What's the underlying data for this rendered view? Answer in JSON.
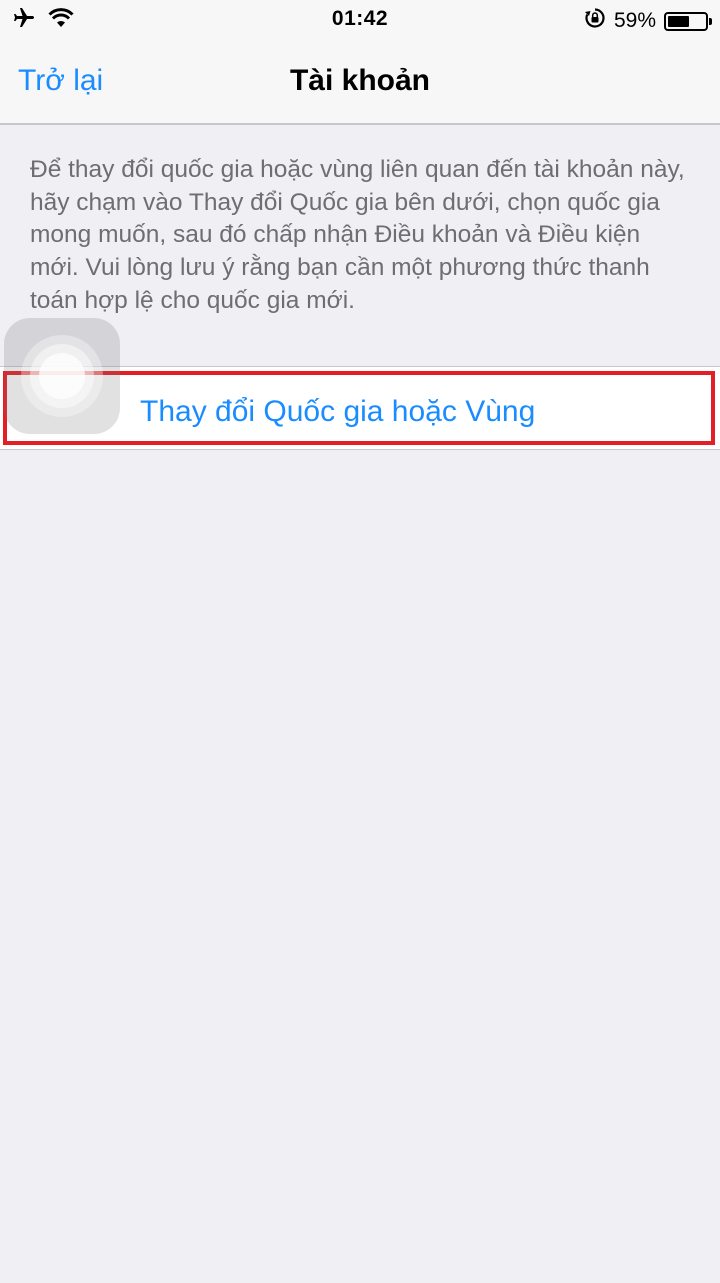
{
  "status_bar": {
    "time": "01:42",
    "battery_percent": "59%",
    "battery_level": 0.59,
    "icons": [
      "airplane-icon",
      "wifi-icon",
      "rotation-lock-icon",
      "battery-icon"
    ]
  },
  "nav": {
    "back_label": "Trở lại",
    "title": "Tài khoản"
  },
  "description": "Để thay đổi quốc gia hoặc vùng liên quan đến tài khoản này, hãy chạm vào Thay đổi Quốc gia bên dưới, chọn quốc gia mong muốn, sau đó chấp nhận Điều khoản và Điều kiện mới. Vui lòng lưu ý rằng bạn cần một phương thức thanh toán hợp lệ cho quốc gia mới.",
  "change_region": {
    "label": "Thay đổi Quốc gia hoặc Vùng"
  },
  "colors": {
    "accent": "#1a8cff",
    "highlight_border": "#e31e24",
    "background": "#efeff4",
    "secondary_text": "#6d6d72"
  }
}
